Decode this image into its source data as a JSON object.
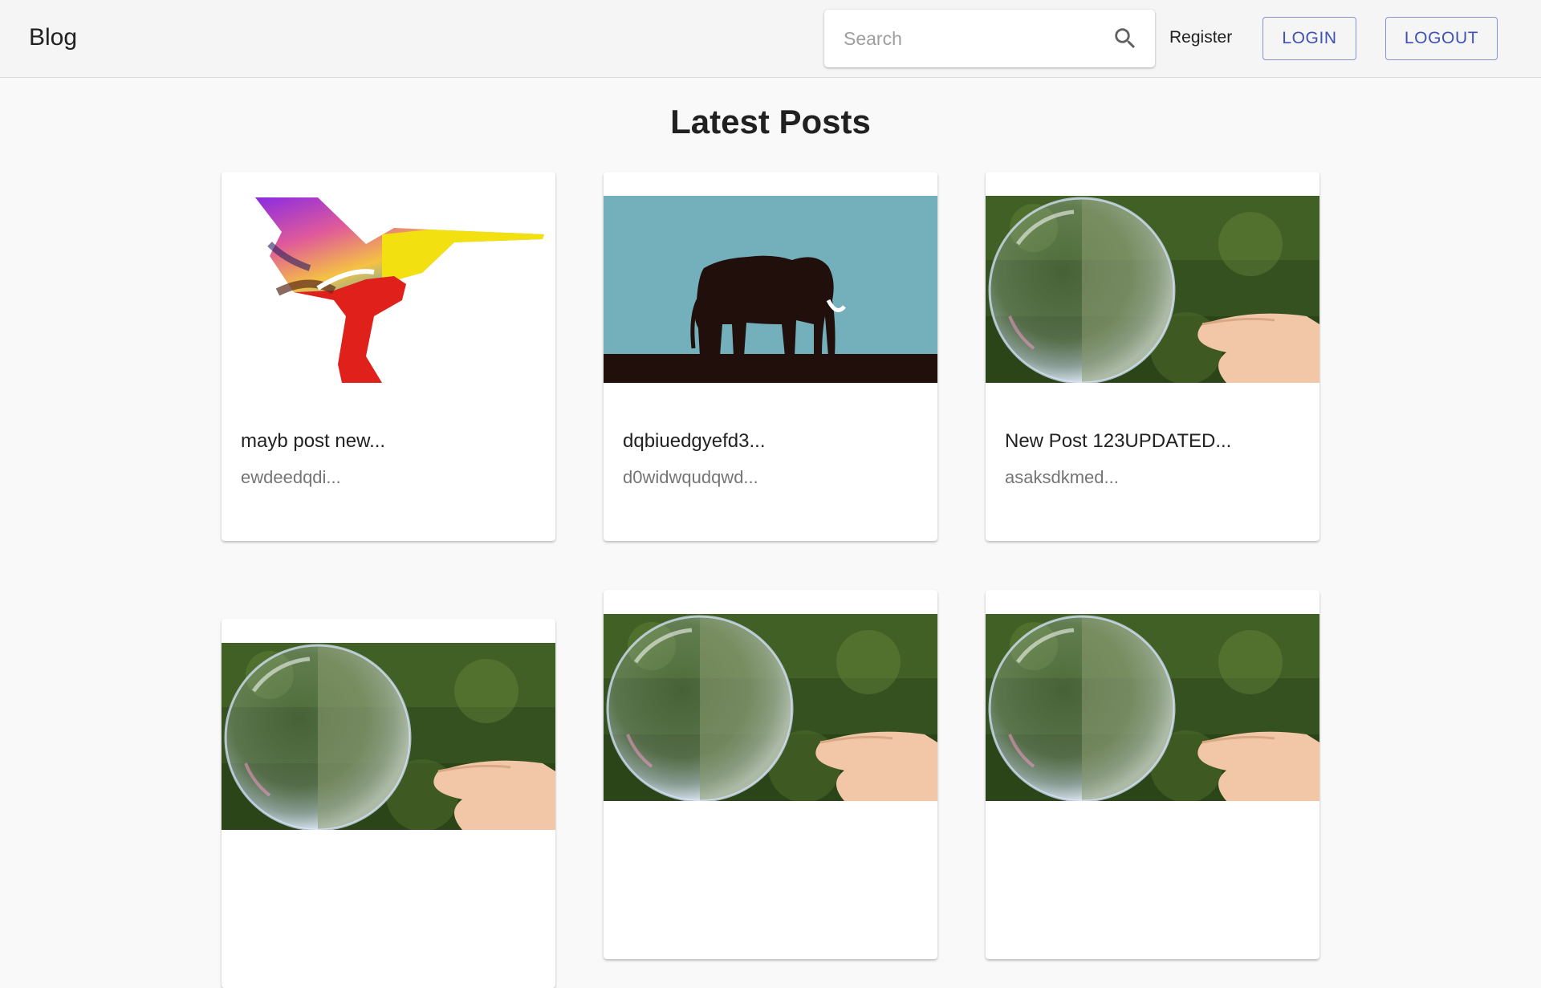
{
  "app": {
    "brand": "Blog"
  },
  "search": {
    "placeholder": "Search",
    "value": ""
  },
  "nav": {
    "register": "Register",
    "login": "LOGIN",
    "logout": "LOGOUT"
  },
  "main": {
    "title": "Latest Posts"
  },
  "posts": [
    {
      "title": "mayb post new...",
      "excerpt": "ewdeedqdi...",
      "image": "abstract-bird-icon"
    },
    {
      "title": "dqbiuedgyefd3...",
      "excerpt": "d0widwqudqwd...",
      "image": "elephant-icon"
    },
    {
      "title": "New Post 123UPDATED...",
      "excerpt": "asaksdkmed...",
      "image": "bubble-photo"
    },
    {
      "title": "",
      "excerpt": "",
      "image": "bubble-photo"
    },
    {
      "title": "",
      "excerpt": "",
      "image": "bubble-photo"
    },
    {
      "title": "",
      "excerpt": "",
      "image": "bubble-photo"
    }
  ],
  "colors": {
    "accent": "#3f51b5",
    "appbar": "#f5f5f5",
    "background": "#f9f9f9"
  }
}
